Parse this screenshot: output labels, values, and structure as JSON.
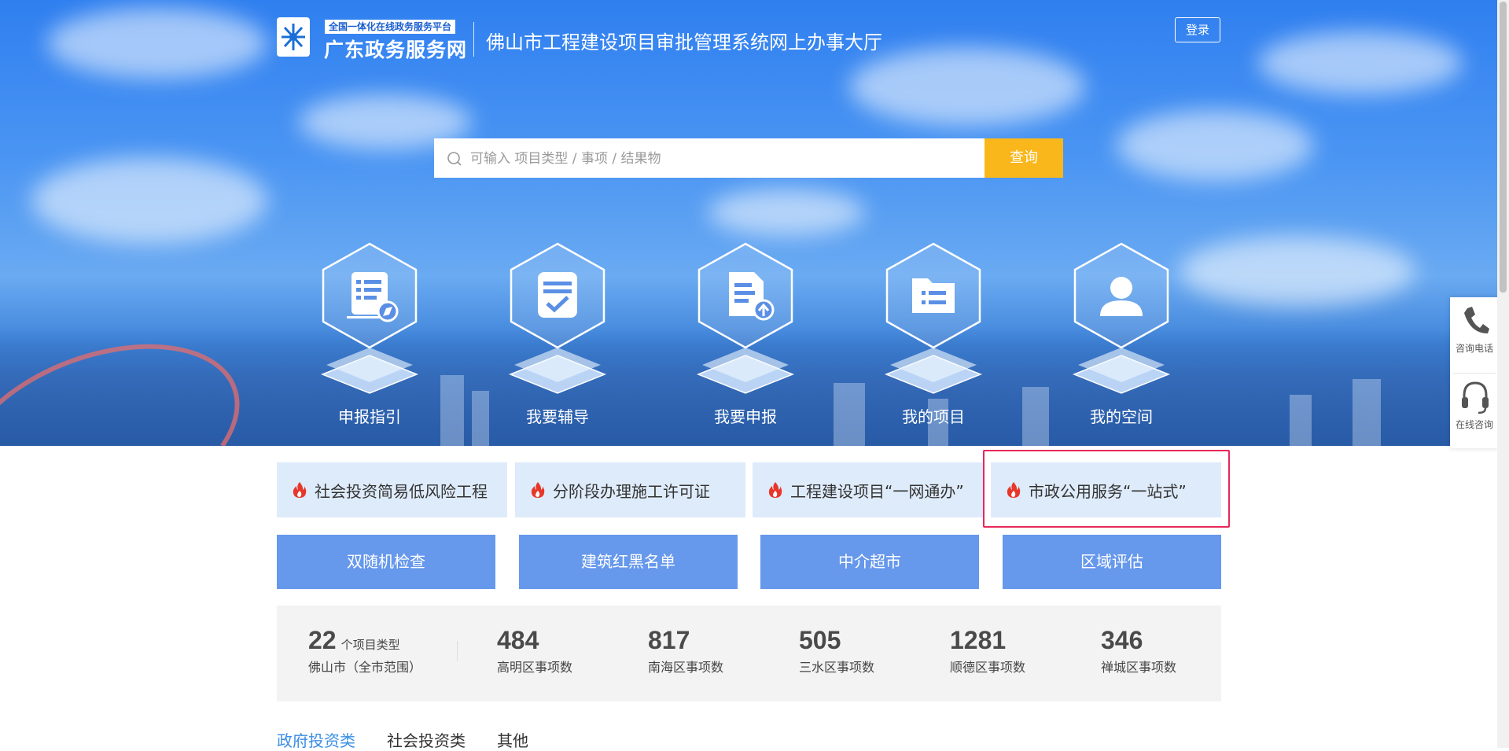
{
  "header": {
    "logo_tag": "全国一体化在线政务服务平台",
    "logo_name": "广东政务服务网",
    "site_title": "佛山市工程建设项目审批管理系统网上办事大厅",
    "login_label": "登录"
  },
  "search": {
    "placeholder": "可输入 项目类型 / 事项 / 结果物",
    "button_label": "查询"
  },
  "nav": [
    {
      "label": "申报指引",
      "icon": "document-compass-icon"
    },
    {
      "label": "我要辅导",
      "icon": "clipboard-check-icon"
    },
    {
      "label": "我要申报",
      "icon": "document-upload-icon"
    },
    {
      "label": "我的项目",
      "icon": "folder-list-icon"
    },
    {
      "label": "我的空间",
      "icon": "user-icon"
    }
  ],
  "float": {
    "phone_label": "咨询电话",
    "online_label": "在线咨询"
  },
  "hot_links": [
    {
      "label": "社会投资简易低风险工程"
    },
    {
      "label": "分阶段办理施工许可证"
    },
    {
      "label": "工程建设项目“一网通办”"
    },
    {
      "label": "市政公用服务“一站式”"
    }
  ],
  "buttons": [
    "双随机检查",
    "建筑红黑名单",
    "中介超市",
    "区域评估"
  ],
  "stats": {
    "total": {
      "num": "22",
      "unit": "个项目类型",
      "desc": "佛山市（全市范围）"
    },
    "districts": [
      {
        "num": "484",
        "desc": "高明区事项数"
      },
      {
        "num": "817",
        "desc": "南海区事项数"
      },
      {
        "num": "505",
        "desc": "三水区事项数"
      },
      {
        "num": "1281",
        "desc": "顺德区事项数"
      },
      {
        "num": "346",
        "desc": "禅城区事项数"
      }
    ]
  },
  "tabs": [
    {
      "label": "政府投资类",
      "active": true
    },
    {
      "label": "社会投资类",
      "active": false
    },
    {
      "label": "其他",
      "active": false
    }
  ],
  "colors": {
    "accent_yellow": "#f9b71b",
    "button_blue": "#6698ec",
    "hot_bg": "#deebfa",
    "active_tab": "#3a8ee6",
    "highlight_border": "#e8275a"
  }
}
